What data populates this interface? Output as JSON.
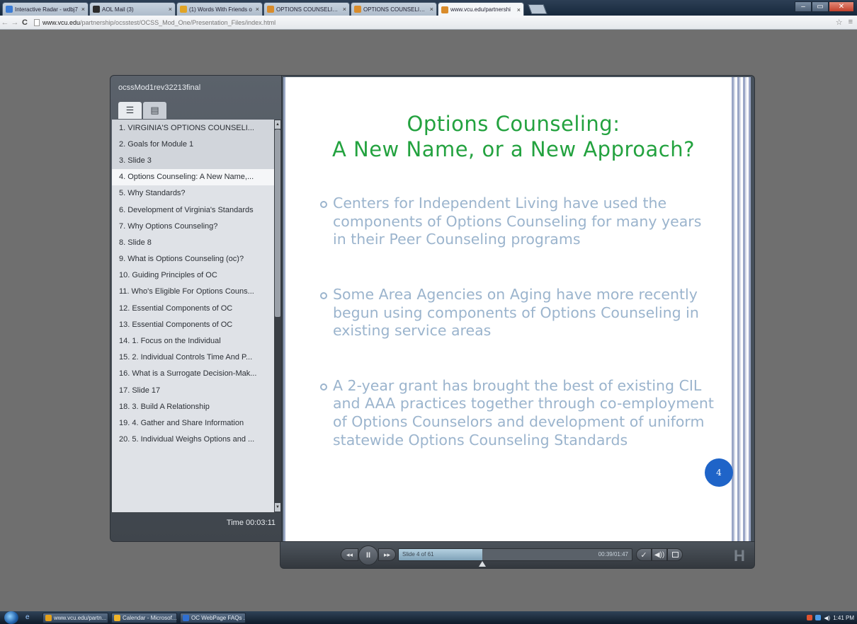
{
  "browser": {
    "tabs": [
      {
        "title": "Interactive Radar - wdbj7",
        "color": "#3a7bd5"
      },
      {
        "title": "AOL Mail (3)",
        "color": "#2b2b2b"
      },
      {
        "title": "(1) Words With Friends o",
        "color": "#e1a425"
      },
      {
        "title": "OPTIONS COUNSELING S",
        "color": "#d98c2b"
      },
      {
        "title": "OPTIONS COUNSELING S",
        "color": "#d98c2b"
      },
      {
        "title": "www.vcu.edu/partnershi",
        "color": "#d98c2b"
      }
    ],
    "url_host": "www.vcu.edu",
    "url_path": "/partnership/ocsstest/OCSS_Mod_One/Presentation_Files/index.html"
  },
  "player": {
    "title": "ocssMod1rev32213final",
    "outline_icon": "outline-list-icon",
    "notes_icon": "notes-icon",
    "slides": [
      "1. VIRGINIA'S  OPTIONS COUNSELI...",
      "2. Goals for Module 1",
      "3. Slide 3",
      "4. Options Counseling:  A New Name,...",
      "5. Why Standards?",
      "6. Development of Virginia's Standards",
      "7. Why Options Counseling?",
      "8. Slide 8",
      "9. What is Options Counseling (oc)?",
      "10. Guiding Principles of OC",
      "11. Who's Eligible For  Options Couns...",
      "12. Essential Components of OC",
      "13. Essential Components of OC",
      "14. 1. Focus on the Individual",
      "15. 2.  Individual Controls Time  And P...",
      "16. What is a Surrogate  Decision-Mak...",
      "17. Slide 17",
      "18. 3. Build A Relationship",
      "19. 4.  Gather and Share Information",
      "20. 5.  Individual Weighs Options and ..."
    ],
    "current_index": 3,
    "time": "Time 00:03:11",
    "slide_position": "Slide 4 of 61",
    "elapsed": "00:39/01:47",
    "progress": 0.36
  },
  "slide": {
    "title_line1": "Options Counseling:",
    "title_line2": "A New Name, or a New Approach?",
    "bullets": [
      "Centers for Independent Living have used the components of Options Counseling for many years in their Peer Counseling programs",
      "Some Area Agencies on Aging have more recently begun using components of Options Counseling in existing service areas",
      "A 2-year grant has brought the best of existing CIL and AAA practices together through co-employment of Options Counselors and development of uniform statewide Options Counseling Standards"
    ],
    "number": "4"
  },
  "controls": {
    "prev": "◂◂",
    "play": "II",
    "next": "▸▸",
    "cc": "✓",
    "volume": "◀))",
    "logo": "H"
  },
  "taskbar": {
    "buttons": [
      {
        "title": "www.vcu.edu/partn...",
        "color": "#e4a11b"
      },
      {
        "title": "Calendar - Microsof...",
        "color": "#f0b429"
      },
      {
        "title": "OC WebPage FAQs ...",
        "color": "#2f6fd1"
      }
    ],
    "clock": "1:41 PM"
  }
}
